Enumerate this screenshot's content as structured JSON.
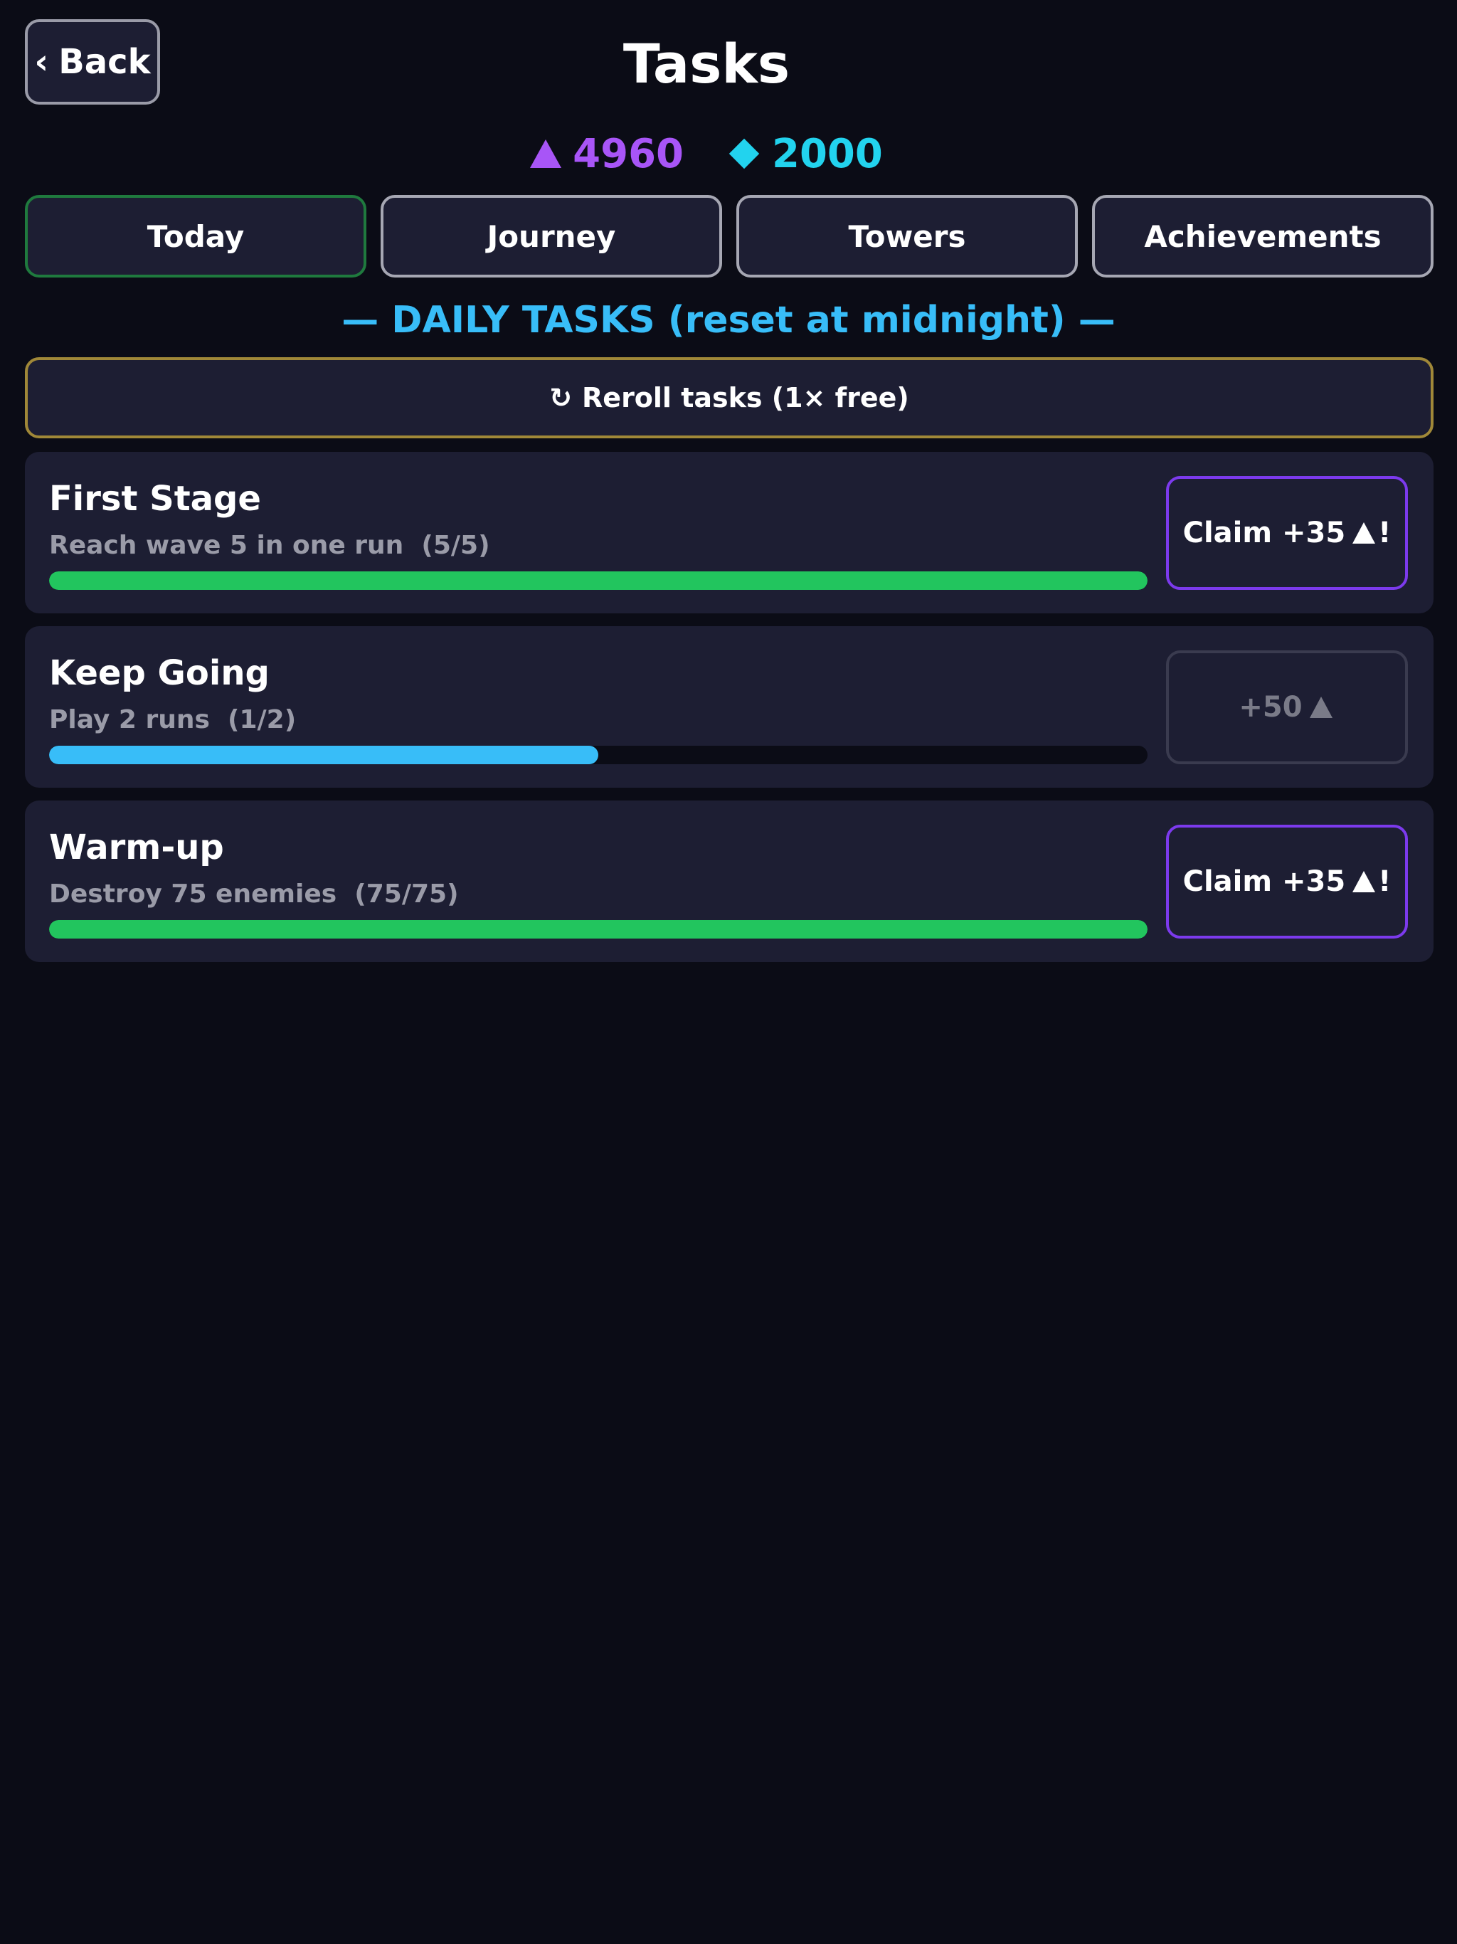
{
  "header": {
    "back_label": "Back",
    "back_icon": "‹",
    "title": "Tasks"
  },
  "currencies": {
    "gems_value": "4960",
    "gems_color": "#a855f7",
    "crystals_value": "2000",
    "crystals_color": "#22d3ee"
  },
  "tabs": [
    {
      "label": "Today",
      "active": true
    },
    {
      "label": "Journey",
      "active": false
    },
    {
      "label": "Towers",
      "active": false
    },
    {
      "label": "Achievements",
      "active": false
    }
  ],
  "section": {
    "heading": "— DAILY TASKS (reset at midnight) —",
    "reroll_icon": "↻",
    "reroll_label": "Reroll tasks (1× free)"
  },
  "tasks": [
    {
      "name": "First Stage",
      "desc": "Reach wave 5 in one run  (5/5)",
      "progress": 1.0,
      "bar_color": "green",
      "button_prefix": "Claim +35",
      "button_suffix": "!",
      "claimable": true
    },
    {
      "name": "Keep Going",
      "desc": "Play 2 runs  (1/2)",
      "progress": 0.5,
      "bar_color": "blue",
      "button_prefix": "+50",
      "button_suffix": "",
      "claimable": false
    },
    {
      "name": "Warm-up",
      "desc": "Destroy 75 enemies  (75/75)",
      "progress": 1.0,
      "bar_color": "green",
      "button_prefix": "Claim +35",
      "button_suffix": "!",
      "claimable": true
    }
  ]
}
